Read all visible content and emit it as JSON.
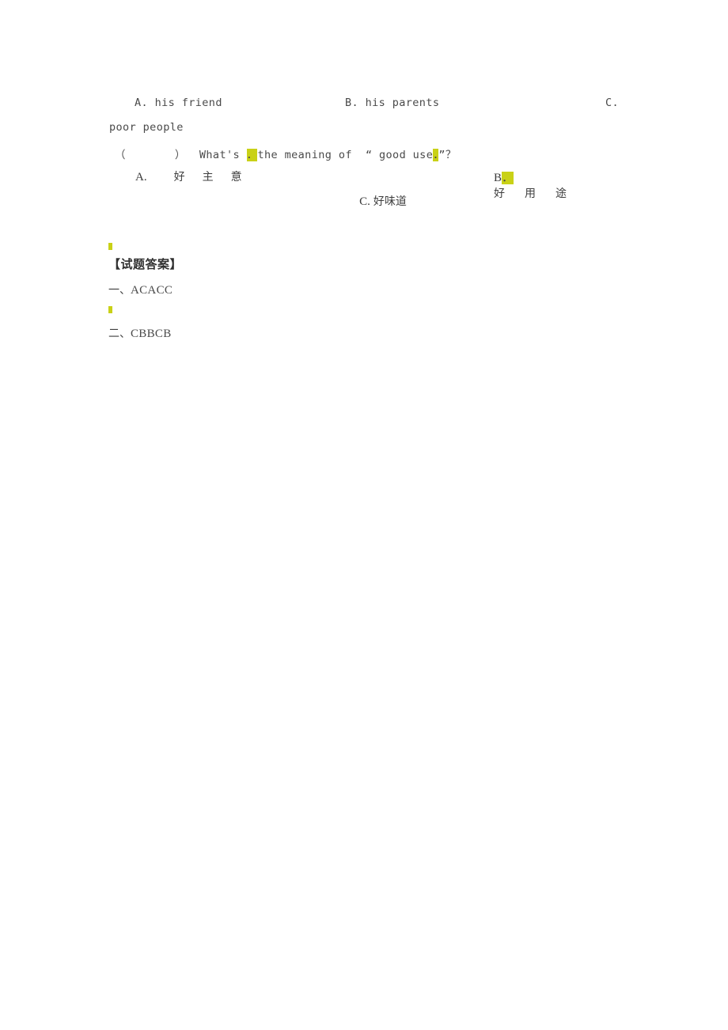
{
  "document": {
    "language": "zh-CN",
    "highlight_color": "#c9d117",
    "text_color": "#4a4a4a"
  },
  "question_block": {
    "previous_question_options": {
      "option_a": "A. his friend",
      "option_b": "B. his parents",
      "option_c_label": "C.",
      "option_c_continuation": "poor people"
    },
    "question": {
      "bracket_open": "（",
      "bracket_close": "）",
      "stem_part_1": "What's",
      "highlighted_period_1": "．",
      "stem_part_2": "the meaning of ",
      "quote_open": "“",
      "quoted_text": "good use",
      "highlighted_period_2": "．",
      "quote_close": "”",
      "question_mark": "？"
    },
    "options": {
      "a_label": "A.",
      "a_text": "好主意",
      "b_label": "B",
      "b_label_highlighted_period": "．",
      "b_text": "好用途",
      "c_label": "C.",
      "c_text": "好味道"
    }
  },
  "answer_key": {
    "heading": "【试题答案】",
    "entries": [
      {
        "number": "一、",
        "answers": "ACACC"
      },
      {
        "number": "二、",
        "answers": "CBBCB"
      }
    ],
    "marks": [
      {
        "name": "highlight-mark-1"
      },
      {
        "name": "highlight-mark-2"
      }
    ]
  }
}
